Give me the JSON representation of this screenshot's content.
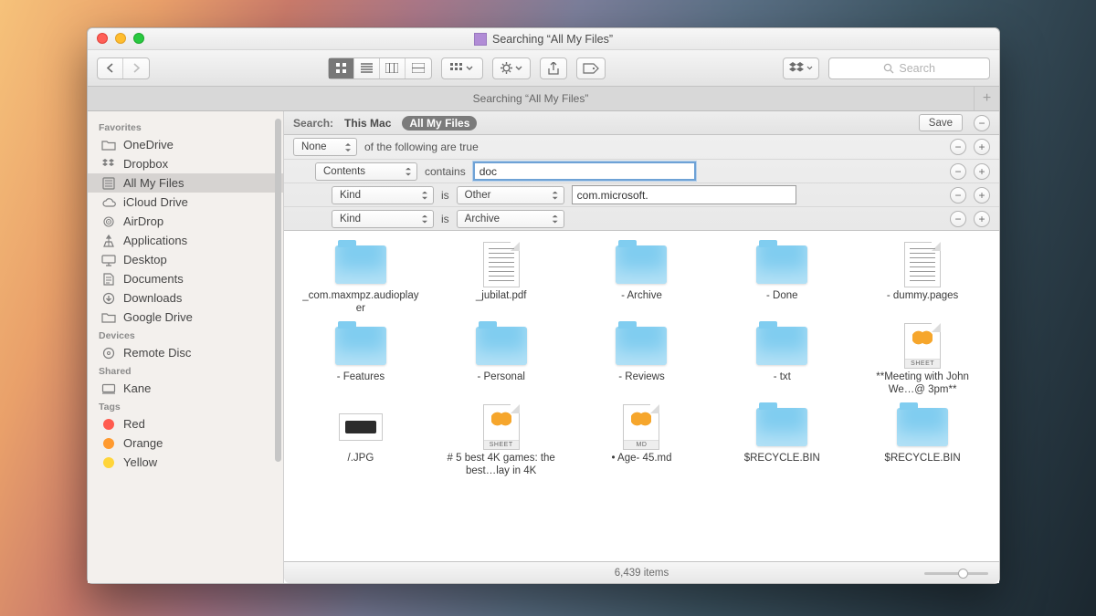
{
  "window_title": "Searching “All My Files”",
  "tab_title": "Searching “All My Files”",
  "search_placeholder": "Search",
  "scope": {
    "label": "Search:",
    "option1": "This Mac",
    "option2": "All My Files",
    "save": "Save"
  },
  "criteria": {
    "r0": {
      "attr": "None",
      "text": "of the following are true"
    },
    "r1": {
      "attr": "Contents",
      "op": "contains",
      "value": "doc"
    },
    "r2": {
      "attr": "Kind",
      "op": "is",
      "kind": "Other",
      "value": "com.microsoft."
    },
    "r3": {
      "attr": "Kind",
      "op": "is",
      "kind": "Archive"
    }
  },
  "sidebar": {
    "sections": [
      {
        "label": "Favorites",
        "items": [
          {
            "label": "OneDrive",
            "icon": "folder"
          },
          {
            "label": "Dropbox",
            "icon": "dropbox"
          },
          {
            "label": "All My Files",
            "icon": "allfiles",
            "selected": true
          },
          {
            "label": "iCloud Drive",
            "icon": "cloud"
          },
          {
            "label": "AirDrop",
            "icon": "airdrop"
          },
          {
            "label": "Applications",
            "icon": "apps"
          },
          {
            "label": "Desktop",
            "icon": "desktop"
          },
          {
            "label": "Documents",
            "icon": "documents"
          },
          {
            "label": "Downloads",
            "icon": "downloads"
          },
          {
            "label": "Google Drive",
            "icon": "folder"
          }
        ]
      },
      {
        "label": "Devices",
        "items": [
          {
            "label": "Remote Disc",
            "icon": "disc"
          }
        ]
      },
      {
        "label": "Shared",
        "items": [
          {
            "label": "Kane",
            "icon": "computer"
          }
        ]
      },
      {
        "label": "Tags",
        "items": [
          {
            "label": "Red",
            "icon": "tag",
            "color": "#ff5b4f"
          },
          {
            "label": "Orange",
            "icon": "tag",
            "color": "#ff9a2f"
          },
          {
            "label": "Yellow",
            "icon": "tag",
            "color": "#ffd53a"
          }
        ]
      }
    ]
  },
  "results": [
    {
      "type": "folder",
      "label": "_com.maxmpz.audioplayer"
    },
    {
      "type": "doc",
      "label": "_jubilat.pdf"
    },
    {
      "type": "folder",
      "label": "- Archive"
    },
    {
      "type": "folder",
      "label": "- Done"
    },
    {
      "type": "doc",
      "label": "- dummy.pages"
    },
    {
      "type": "folder",
      "label": "- Features"
    },
    {
      "type": "folder",
      "label": "- Personal"
    },
    {
      "type": "folder",
      "label": "- Reviews"
    },
    {
      "type": "folder",
      "label": "- txt"
    },
    {
      "type": "sheet",
      "label": "**Meeting with John We…@ 3pm**"
    },
    {
      "type": "jpg",
      "label": "/.JPG"
    },
    {
      "type": "sheet",
      "label": "# 5 best 4K games: the best…lay in 4K"
    },
    {
      "type": "md",
      "label": "• Age- 45.md"
    },
    {
      "type": "folder",
      "label": "$RECYCLE.BIN"
    },
    {
      "type": "folder",
      "label": "$RECYCLE.BIN"
    }
  ],
  "status": "6,439 items"
}
